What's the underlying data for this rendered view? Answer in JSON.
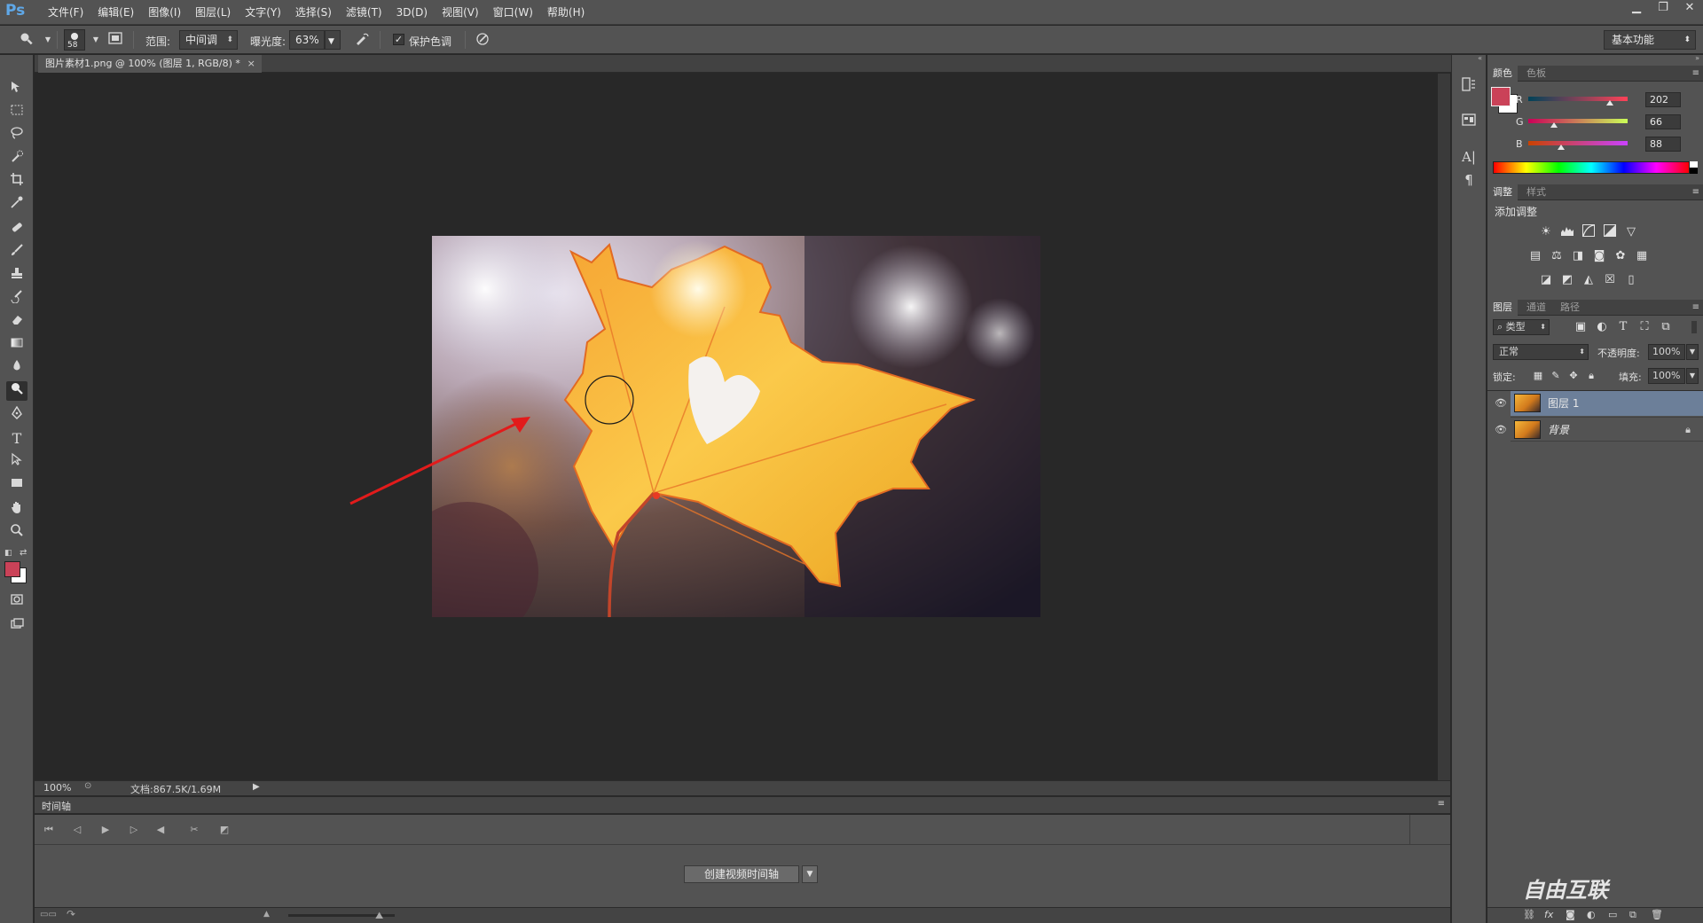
{
  "app": {
    "logo": "Ps"
  },
  "menu": [
    "文件(F)",
    "编辑(E)",
    "图像(I)",
    "图层(L)",
    "文字(Y)",
    "选择(S)",
    "滤镜(T)",
    "3D(D)",
    "视图(V)",
    "窗口(W)",
    "帮助(H)"
  ],
  "window_controls": {
    "minimize": "▁",
    "restore": "❐",
    "close": "✕"
  },
  "options": {
    "brush_size": "58",
    "range_label": "范围:",
    "range_value": "中间调",
    "exposure_label": "曝光度:",
    "exposure_value": "63%",
    "protect_tones_label": "保护色调",
    "protect_tones_checked": true,
    "workspace": "基本功能"
  },
  "document": {
    "tab_title": "图片素材1.png @ 100% (图层 1, RGB/8) *",
    "close_glyph": "×",
    "zoom": "100%",
    "doc_info": "文档:867.5K/1.69M"
  },
  "timeline": {
    "title": "时间轴",
    "create_button": "创建视频时间轴"
  },
  "color_panel": {
    "tabs": [
      "颜色",
      "色板"
    ],
    "foreground": "#ca4258",
    "background": "#ffffff",
    "r_label": "R",
    "r_value": "202",
    "g_label": "G",
    "g_value": "66",
    "b_label": "B",
    "b_value": "88"
  },
  "adjustments_panel": {
    "tabs": [
      "调整",
      "样式"
    ],
    "title": "添加调整"
  },
  "layers_panel": {
    "tabs": [
      "图层",
      "通道",
      "路径"
    ],
    "filter_kind": "类型",
    "blend_mode": "正常",
    "opacity_label": "不透明度:",
    "opacity_value": "100%",
    "lock_label": "锁定:",
    "fill_label": "填充:",
    "fill_value": "100%",
    "layers": [
      {
        "name": "图层 1",
        "selected": true
      },
      {
        "name": "背景",
        "selected": false,
        "locked": true
      }
    ]
  },
  "watermark": "自由互联"
}
